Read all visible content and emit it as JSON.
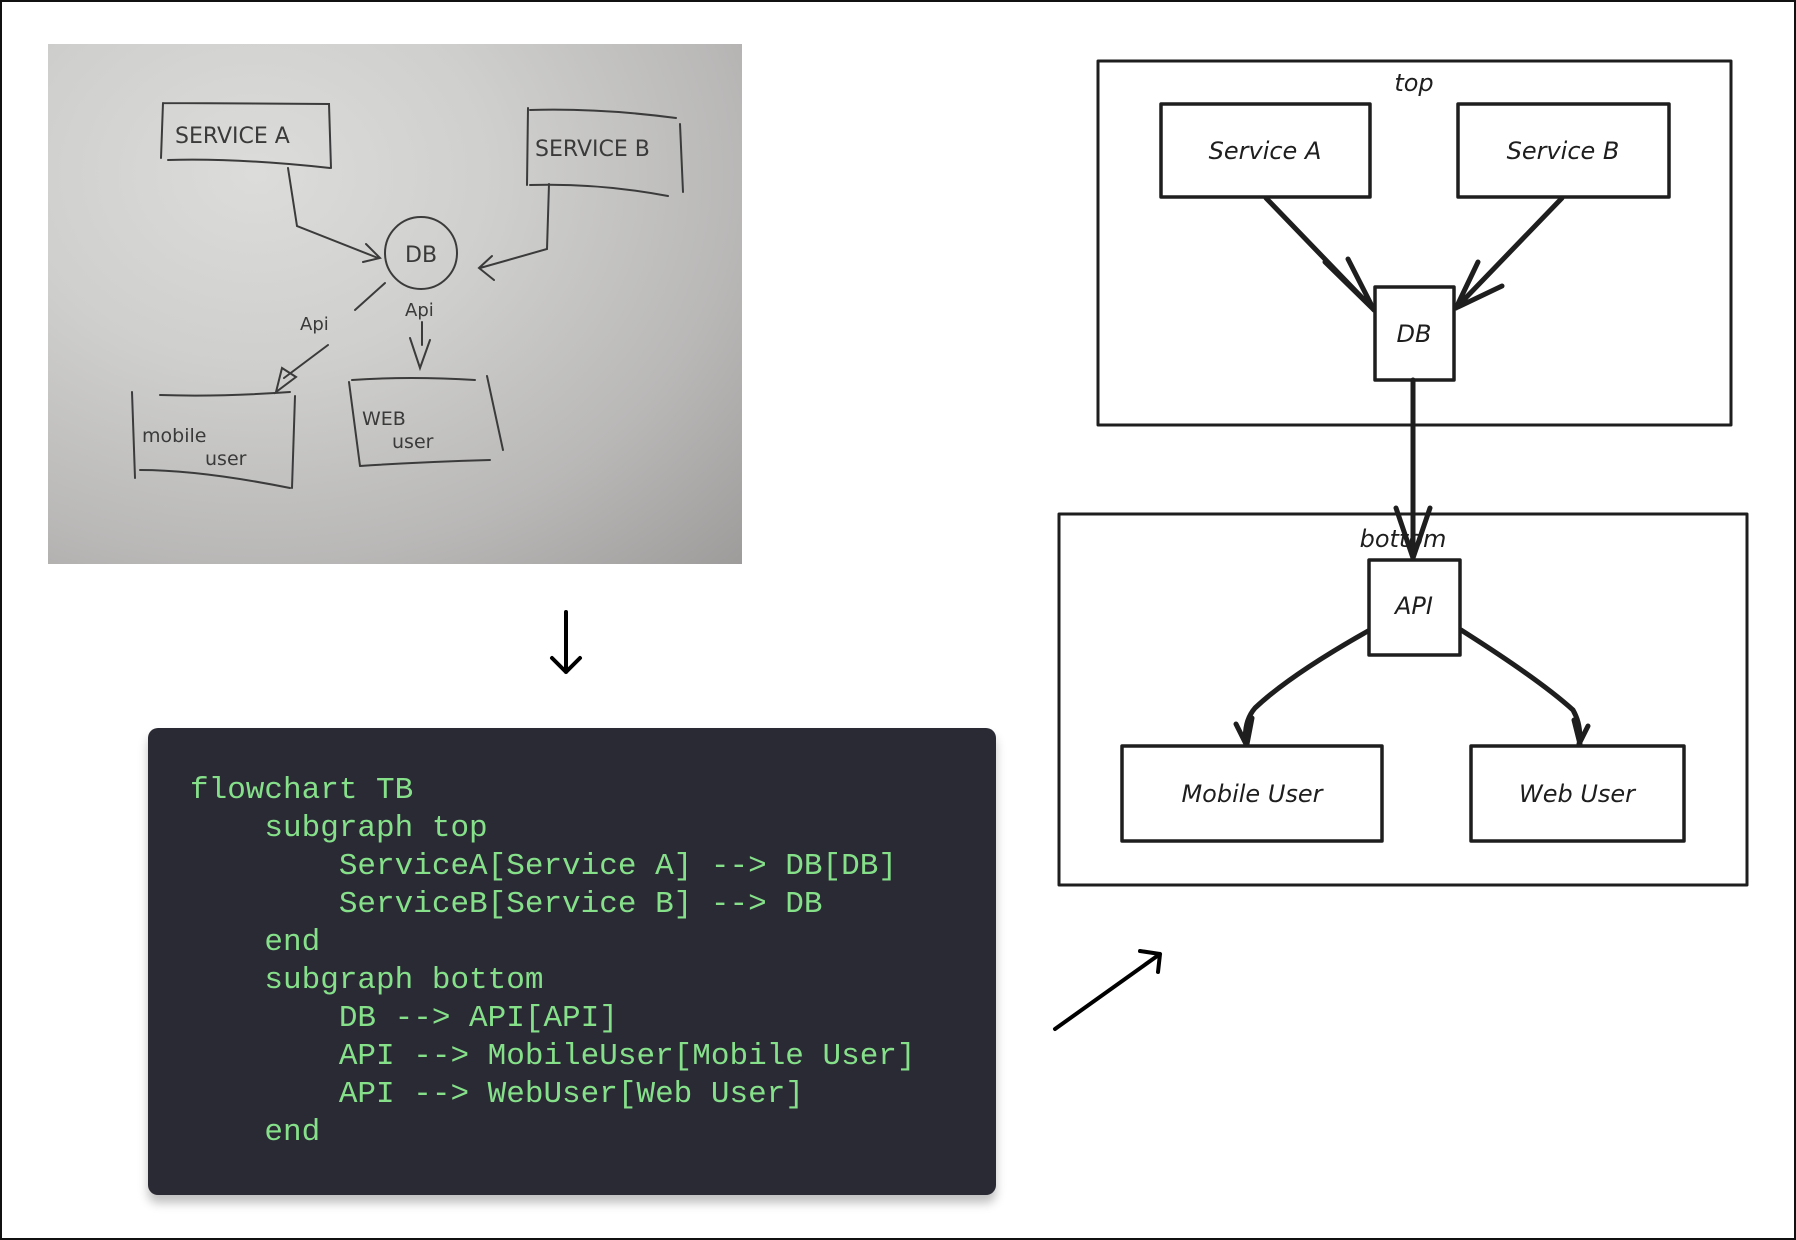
{
  "photo": {
    "description": "hand-drawn whiteboard sketch",
    "nodes": {
      "service_a": "SERVICE A",
      "service_b": "SERVICE B",
      "db": "DB",
      "mobile_user_line1": "mobile",
      "mobile_user_line2": "user",
      "web_user_line1": "WEB",
      "web_user_line2": "user"
    },
    "edge_labels": [
      "Api",
      "Api"
    ]
  },
  "code": {
    "lines": [
      "flowchart TB",
      "    subgraph top",
      "        ServiceA[Service A] --> DB[DB]",
      "        ServiceB[Service B] --> DB",
      "    end",
      "    subgraph bottom",
      "        DB --> API[API]",
      "        API --> MobileUser[Mobile User]",
      "        API --> WebUser[Web User]",
      "    end"
    ],
    "text_color": "#86e08a",
    "background_color": "#2a2a35"
  },
  "diagram": {
    "subgraphs": {
      "top": "top",
      "bottom": "bottom"
    },
    "nodes": {
      "service_a": "Service A",
      "service_b": "Service B",
      "db": "DB",
      "api": "API",
      "mobile_user": "Mobile User",
      "web_user": "Web User"
    },
    "edges": [
      {
        "from": "Service A",
        "to": "DB"
      },
      {
        "from": "Service B",
        "to": "DB"
      },
      {
        "from": "DB",
        "to": "API"
      },
      {
        "from": "API",
        "to": "Mobile User"
      },
      {
        "from": "API",
        "to": "Web User"
      }
    ]
  },
  "flow_arrows": [
    "down-arrow",
    "diagonal-up-right-arrow"
  ]
}
